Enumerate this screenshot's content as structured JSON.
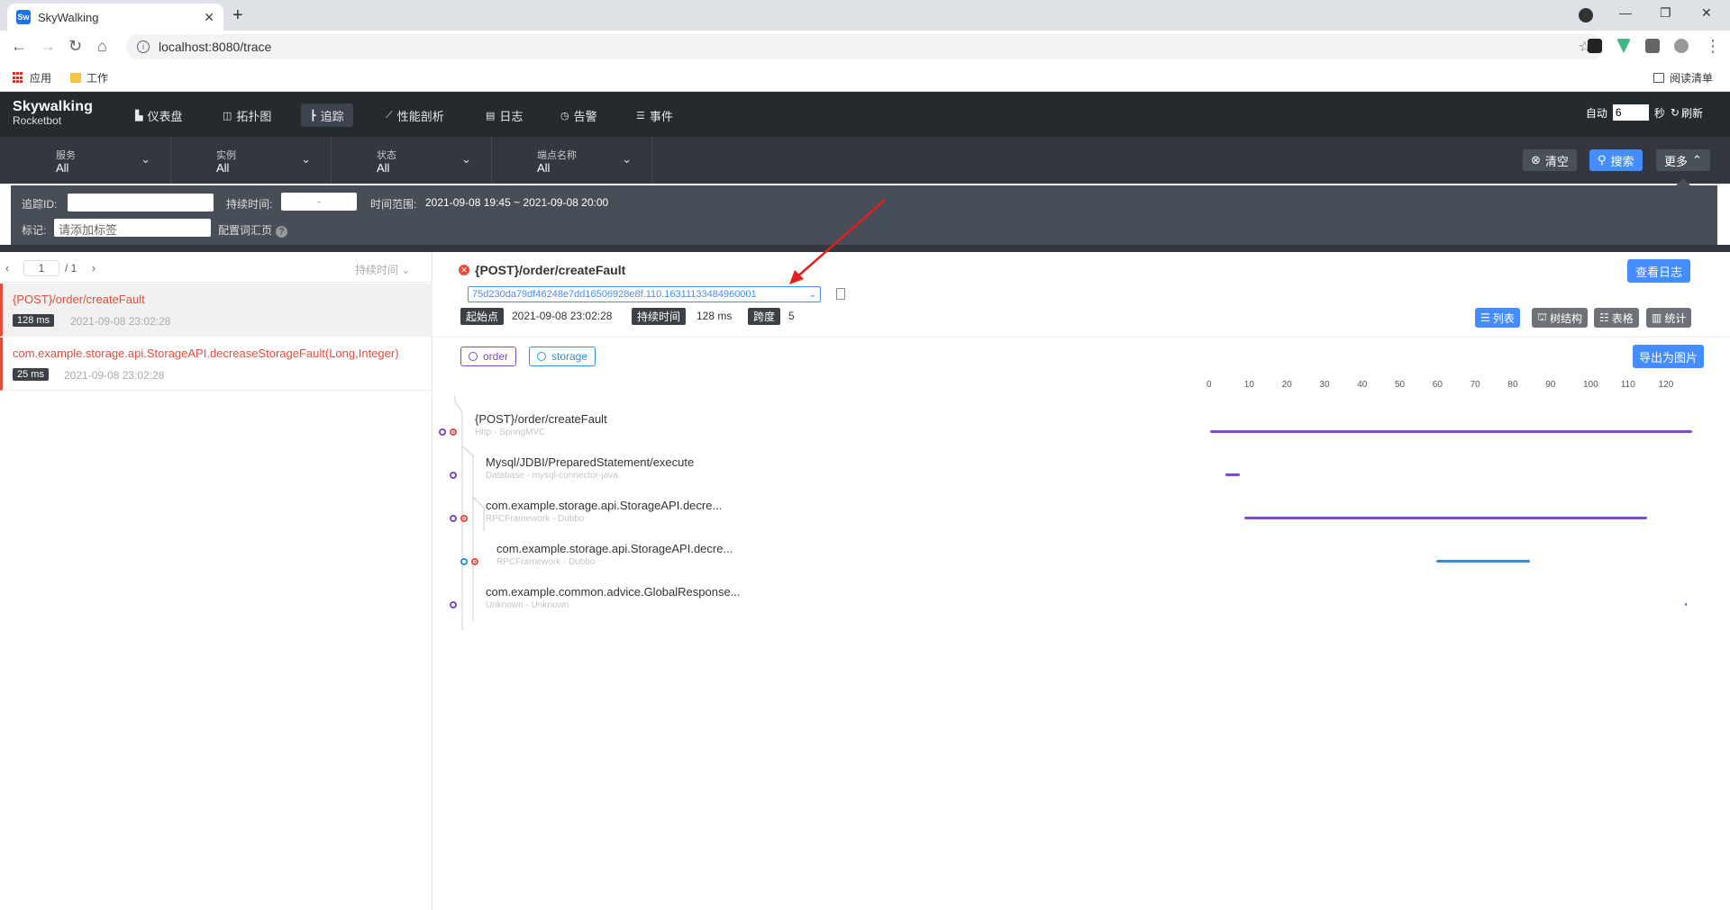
{
  "browser": {
    "tab_title": "SkyWalking",
    "favicon": "Sw",
    "url": "localhost:8080/trace",
    "bookmarks": {
      "apps": "应用",
      "work": "工作",
      "reading_list": "阅读清单"
    }
  },
  "header": {
    "logo_top": "Skywalking",
    "logo_bottom": "Rocketbot",
    "nav": [
      {
        "label": "仪表盘",
        "icon": "dashboard-icon"
      },
      {
        "label": "拓扑图",
        "icon": "topology-icon"
      },
      {
        "label": "追踪",
        "icon": "trace-icon"
      },
      {
        "label": "性能剖析",
        "icon": "profile-icon"
      },
      {
        "label": "日志",
        "icon": "log-icon"
      },
      {
        "label": "告警",
        "icon": "alarm-icon"
      },
      {
        "label": "事件",
        "icon": "event-icon"
      }
    ],
    "auto_label": "自动",
    "interval_value": "6",
    "seconds_label": "秒",
    "refresh_label": "刷新"
  },
  "filters": {
    "selects": [
      {
        "label": "服务",
        "value": "All"
      },
      {
        "label": "实例",
        "value": "All"
      },
      {
        "label": "状态",
        "value": "All"
      },
      {
        "label": "端点名称",
        "value": "All"
      }
    ],
    "clear_label": "清空",
    "search_label": "搜索",
    "more_label": "更多",
    "trace_id_label": "追踪ID:",
    "duration_label": "持续时间:",
    "duration_sep": "-",
    "time_range_label": "时间范围:",
    "time_range_value": "2021-09-08 19:45 ~ 2021-09-08 20:00",
    "tags_label": "标记:",
    "tags_placeholder": "请添加标签",
    "config_vocab_label": "配置词汇页"
  },
  "trace_list": {
    "page": "1",
    "total_pages": "/ 1",
    "sort_label": "持续时间",
    "items": [
      {
        "title": "{POST}/order/createFault",
        "duration": "128 ms",
        "time": "2021-09-08 23:02:28"
      },
      {
        "title": "com.example.storage.api.StorageAPI.decreaseStorageFault(Long,Integer)",
        "duration": "25 ms",
        "time": "2021-09-08 23:02:28"
      }
    ]
  },
  "detail": {
    "title": "{POST}/order/createFault",
    "trace_id": "75d230da79df46248e7dd16506928e8f.110.16311133484960001",
    "start_label": "起始点",
    "start_value": "2021-09-08 23:02:28",
    "duration_label": "持续时间",
    "duration_value": "128 ms",
    "spans_label": "跨度",
    "spans_value": "5",
    "view_logs_label": "查看日志",
    "views": [
      "列表",
      "树结构",
      "表格",
      "统计"
    ],
    "services": [
      "order",
      "storage"
    ],
    "export_label": "导出为图片",
    "axis_ticks": [
      "0",
      "10",
      "20",
      "30",
      "40",
      "50",
      "60",
      "70",
      "80",
      "90",
      "100",
      "110",
      "120"
    ],
    "spans": [
      {
        "name": "{POST}/order/createFault",
        "sub": "Http - SpringMVC",
        "start": 0,
        "end": 128,
        "service": "order",
        "error": true
      },
      {
        "name": "Mysql/JDBI/PreparedStatement/execute",
        "sub": "Database - mysql-connector-java",
        "start": 4,
        "end": 8,
        "service": "order",
        "error": false
      },
      {
        "name": "com.example.storage.api.StorageAPI.decre...",
        "sub": "RPCFramework - Dubbo",
        "start": 9,
        "end": 116,
        "service": "order",
        "error": true
      },
      {
        "name": "com.example.storage.api.StorageAPI.decre...",
        "sub": "RPCFramework - Dubbo",
        "start": 60,
        "end": 85,
        "service": "storage",
        "error": true
      },
      {
        "name": "com.example.common.advice.GlobalResponse...",
        "sub": "Unknown - Unknown",
        "start": 126,
        "end": 126.5,
        "service": "order",
        "error": false
      }
    ],
    "colors": {
      "order": "#7a4bd1",
      "storage": "#2d8fd6",
      "error": "#e54c3c",
      "accent": "#448dfe"
    }
  }
}
